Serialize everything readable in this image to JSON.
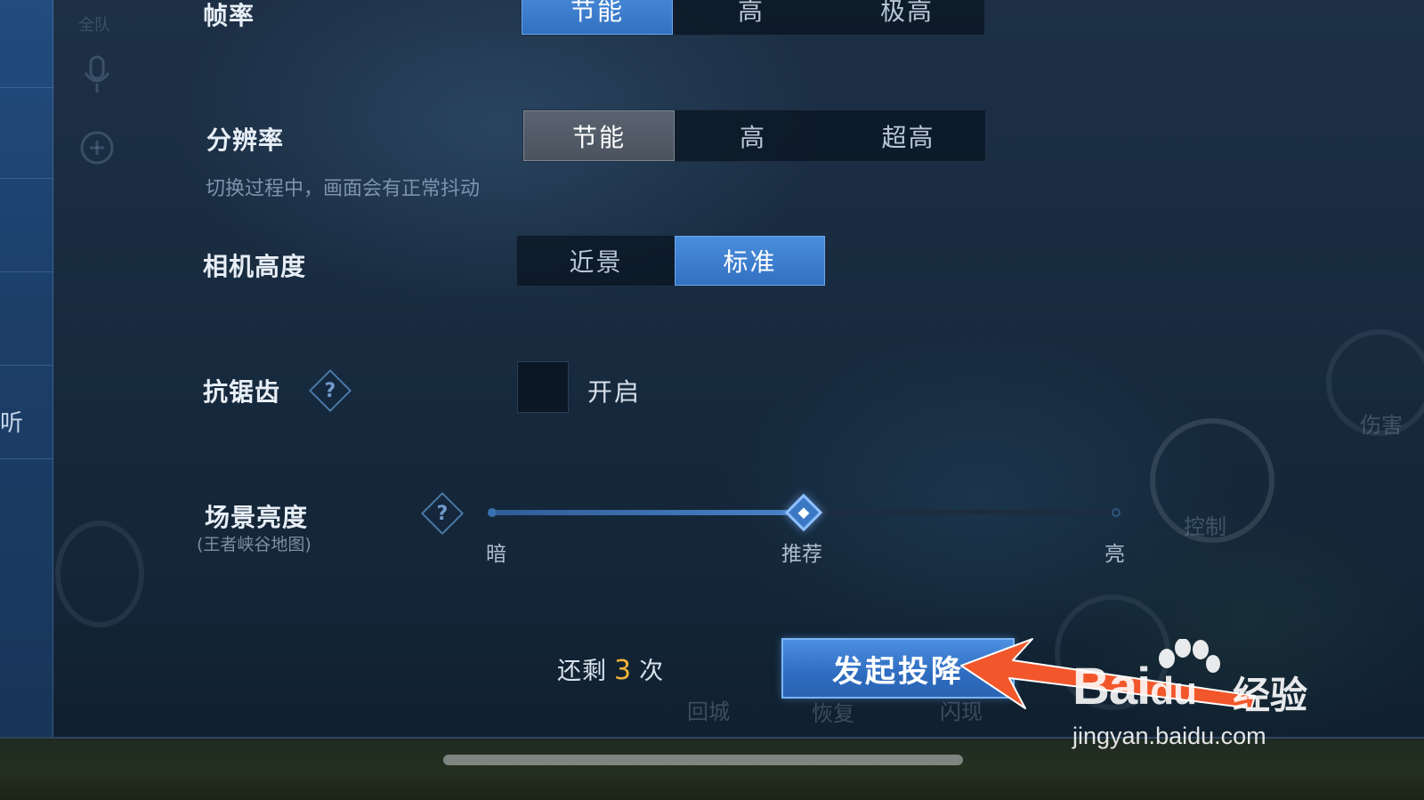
{
  "side": {
    "rail_text": "听",
    "team_label": "全队"
  },
  "settings": {
    "frame_rate": {
      "label": "帧率",
      "options": [
        "节能",
        "高",
        "极高"
      ],
      "selected": "节能"
    },
    "resolution": {
      "label": "分辨率",
      "options": [
        "节能",
        "高",
        "超高"
      ],
      "selected": "节能",
      "hint": "切换过程中，画面会有正常抖动"
    },
    "camera_height": {
      "label": "相机高度",
      "options": [
        "近景",
        "标准"
      ],
      "selected": "标准"
    },
    "anti_aliasing": {
      "label": "抗锯齿",
      "help_glyph": "?",
      "checkbox_label": "开启",
      "checked": false
    },
    "scene_brightness": {
      "label": "场景亮度",
      "sub_label": "(王者峡谷地图)",
      "help_glyph": "?",
      "tick_left": "暗",
      "tick_mid": "推荐",
      "tick_right": "亮",
      "value_fraction": 0.5
    }
  },
  "footer": {
    "remain_prefix": "还剩",
    "remain_count": "3",
    "remain_suffix": "次",
    "surrender_button": "发起投降"
  },
  "background_skills": {
    "recall": "回城",
    "heal": "恢复",
    "flash": "闪现",
    "control": "控制",
    "damage": "伤害"
  },
  "watermark": {
    "brand": "Bai",
    "brand_tail": "du",
    "cn": "经验",
    "url": "jingyan.baidu.com"
  },
  "colors": {
    "accent_blue": "#3b7bd0",
    "count_orange": "#f0b43a",
    "annotation_arrow": "#f2572b"
  }
}
